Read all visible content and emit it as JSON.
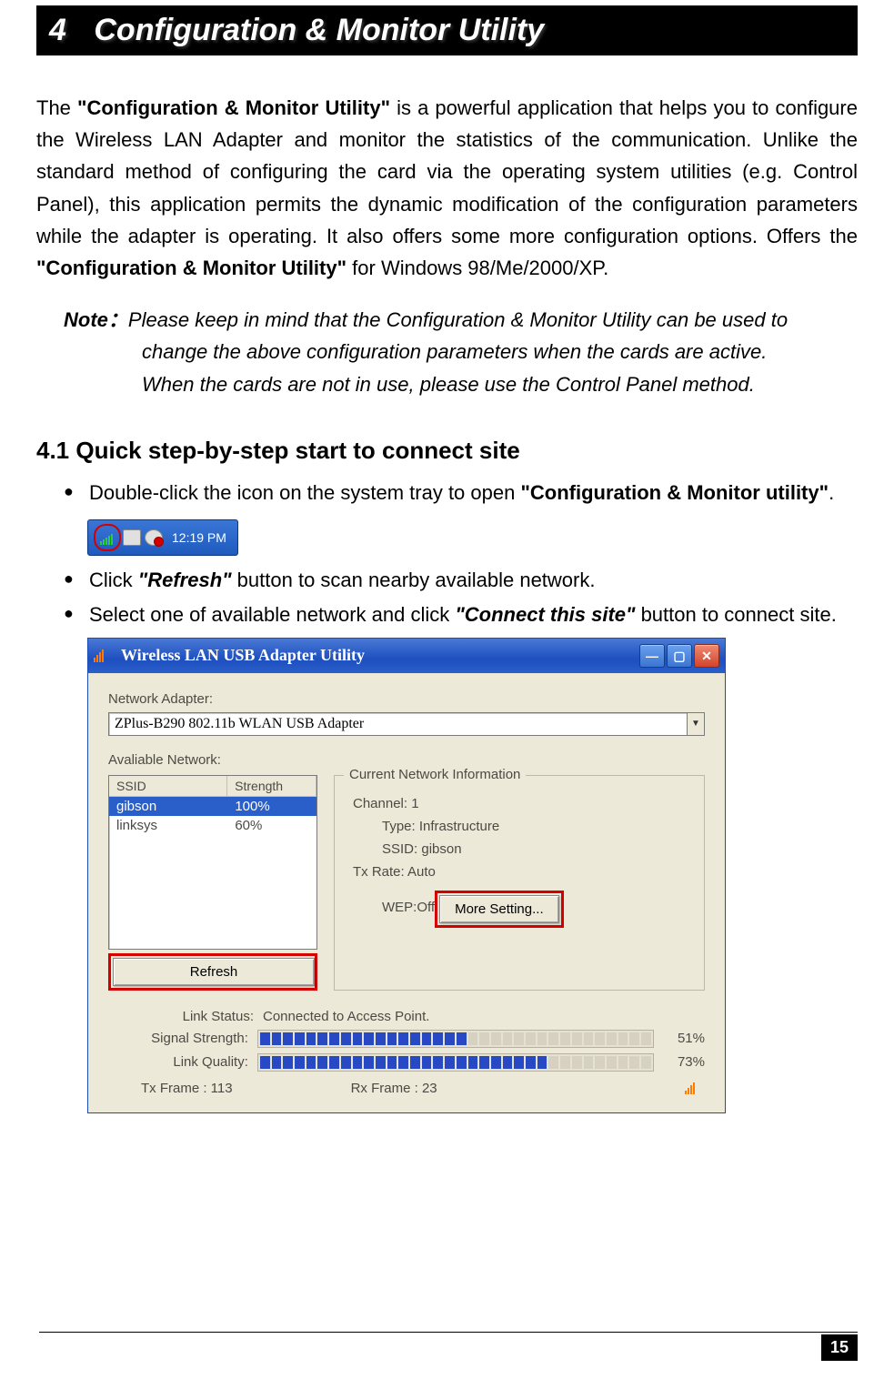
{
  "chapter": {
    "number": "4",
    "title": "Configuration & Monitor Utility"
  },
  "intro": {
    "pre": "The ",
    "bold1": "\"Configuration & Monitor Utility\"",
    "mid": " is a powerful application that helps you to configure the Wireless LAN Adapter and monitor the statistics of the communication. Unlike the standard method of configuring the card via the operating system utilities (e.g. Control Panel), this application permits the dynamic modification of the configuration parameters while the adapter is operating. It also offers some more configuration options. Offers the ",
    "bold2": "\"Configuration & Monitor Utility\"",
    "post": " for Windows 98/Me/2000/XP."
  },
  "note": {
    "label": "Note：",
    "line1": "Please keep in mind that the Configuration & Monitor Utility can be used to",
    "line2": "change the above configuration parameters when the cards are active.",
    "line3": "When the cards are not in use, please use the Control Panel method."
  },
  "section41": "4.1  Quick step-by-step start to connect site",
  "bullet1": {
    "text": "Double-click the icon on the system tray to open ",
    "bold": "\"Configuration & Monitor utility\"",
    "tail": "."
  },
  "bullet2": {
    "text": "Click ",
    "bold": "\"Refresh\"",
    "tail": " button to scan nearby available network."
  },
  "bullet3": {
    "text": "Select one of available network and click ",
    "bold": "\"Connect this site\"",
    "tail": " button to connect site."
  },
  "systray": {
    "time": "12:19 PM"
  },
  "utilwin": {
    "title": "Wireless LAN USB Adapter Utility",
    "labels": {
      "networkAdapter": "Network Adapter:",
      "availableNetwork": "Avaliable Network:",
      "ssidHeader": "SSID",
      "strHeader": "Strength",
      "refresh": "Refresh",
      "groupTitle": "Current Network Information",
      "channel": "Channel: ",
      "type": "Type: ",
      "ssid": "SSID: ",
      "txrate": "Tx Rate: ",
      "wep": "WEP: ",
      "moreSetting": "More Setting...",
      "linkStatus": "Link Status:",
      "signalStrength": "Signal Strength:",
      "linkQuality": "Link Quality:",
      "txFrame": "Tx Frame : ",
      "rxFrame": "Rx Frame : "
    },
    "adapter": "ZPlus-B290 802.11b WLAN USB Adapter",
    "networks": [
      {
        "ssid": "gibson",
        "strength": "100%",
        "selected": true
      },
      {
        "ssid": "linksys",
        "strength": "60%",
        "selected": false
      }
    ],
    "info": {
      "channel": "1",
      "type": "Infrastructure",
      "ssid": "gibson",
      "txrate": "Auto",
      "wep": "Off"
    },
    "status": {
      "linkStatus": "Connected to Access Point.",
      "signalPct": "51%",
      "signalCells": 18,
      "qualityPct": "73%",
      "qualityCells": 25,
      "totalCells": 34,
      "txFrame": "113",
      "rxFrame": "23"
    }
  },
  "pageNumber": "15"
}
